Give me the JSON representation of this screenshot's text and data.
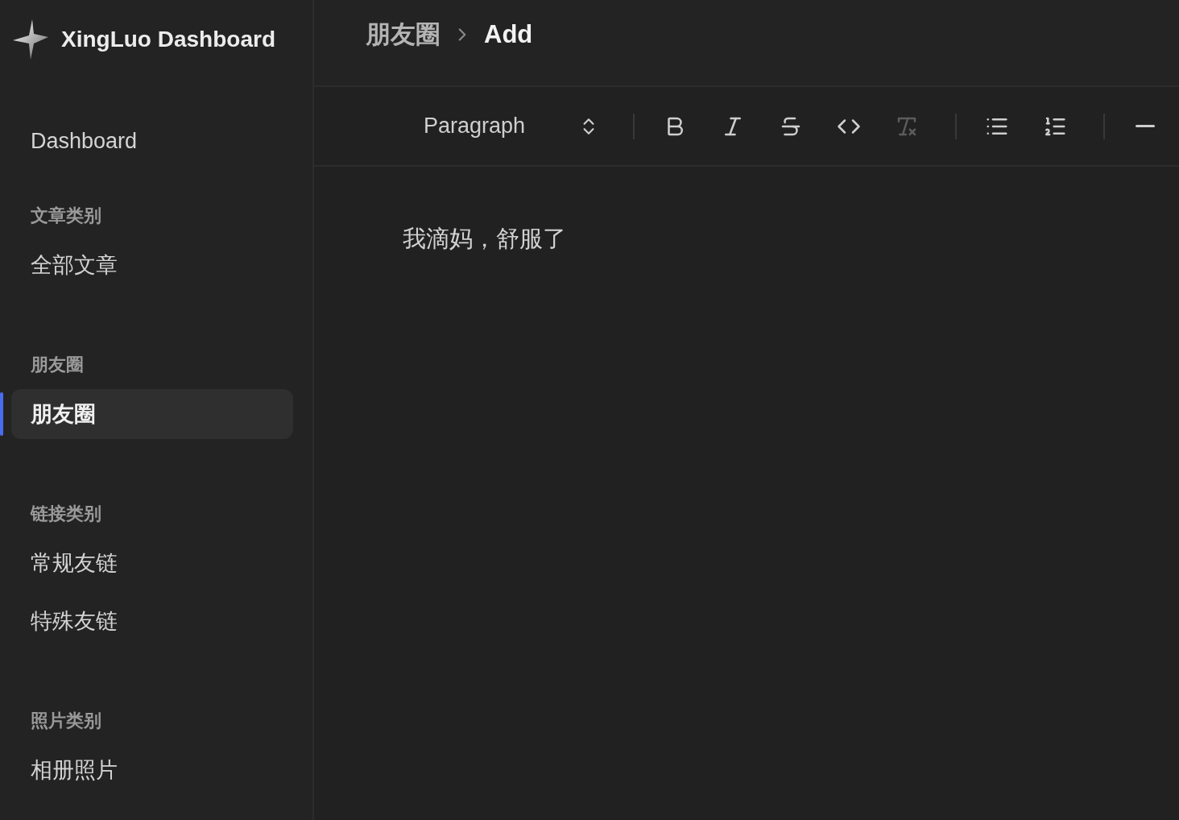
{
  "sidebar": {
    "title": "XingLuo Dashboard",
    "top_item": {
      "label": "Dashboard",
      "selected": false
    },
    "groups": [
      {
        "heading": "文章类别",
        "items": [
          {
            "label": "全部文章",
            "selected": false
          }
        ]
      },
      {
        "heading": "朋友圈",
        "items": [
          {
            "label": "朋友圈",
            "selected": true
          }
        ]
      },
      {
        "heading": "链接类别",
        "items": [
          {
            "label": "常规友链",
            "selected": false
          },
          {
            "label": "特殊友链",
            "selected": false
          }
        ]
      },
      {
        "heading": "照片类别",
        "items": [
          {
            "label": "相册照片",
            "selected": false
          }
        ]
      }
    ]
  },
  "breadcrumb": [
    "朋友圈",
    "Add"
  ],
  "toolbar": [
    {
      "kind": "select",
      "value": "Paragraph"
    },
    {
      "kind": "divider"
    },
    {
      "kind": "bold",
      "disabled": false
    },
    {
      "kind": "italic",
      "disabled": false
    },
    {
      "kind": "strike",
      "disabled": false
    },
    {
      "kind": "code",
      "disabled": false
    },
    {
      "kind": "clear",
      "disabled": true
    },
    {
      "kind": "divider"
    },
    {
      "kind": "bullet",
      "disabled": false
    },
    {
      "kind": "ordered",
      "disabled": false
    },
    {
      "kind": "divider"
    },
    {
      "kind": "rule",
      "disabled": false
    }
  ],
  "editor": {
    "text": "我滴妈，舒服了"
  }
}
